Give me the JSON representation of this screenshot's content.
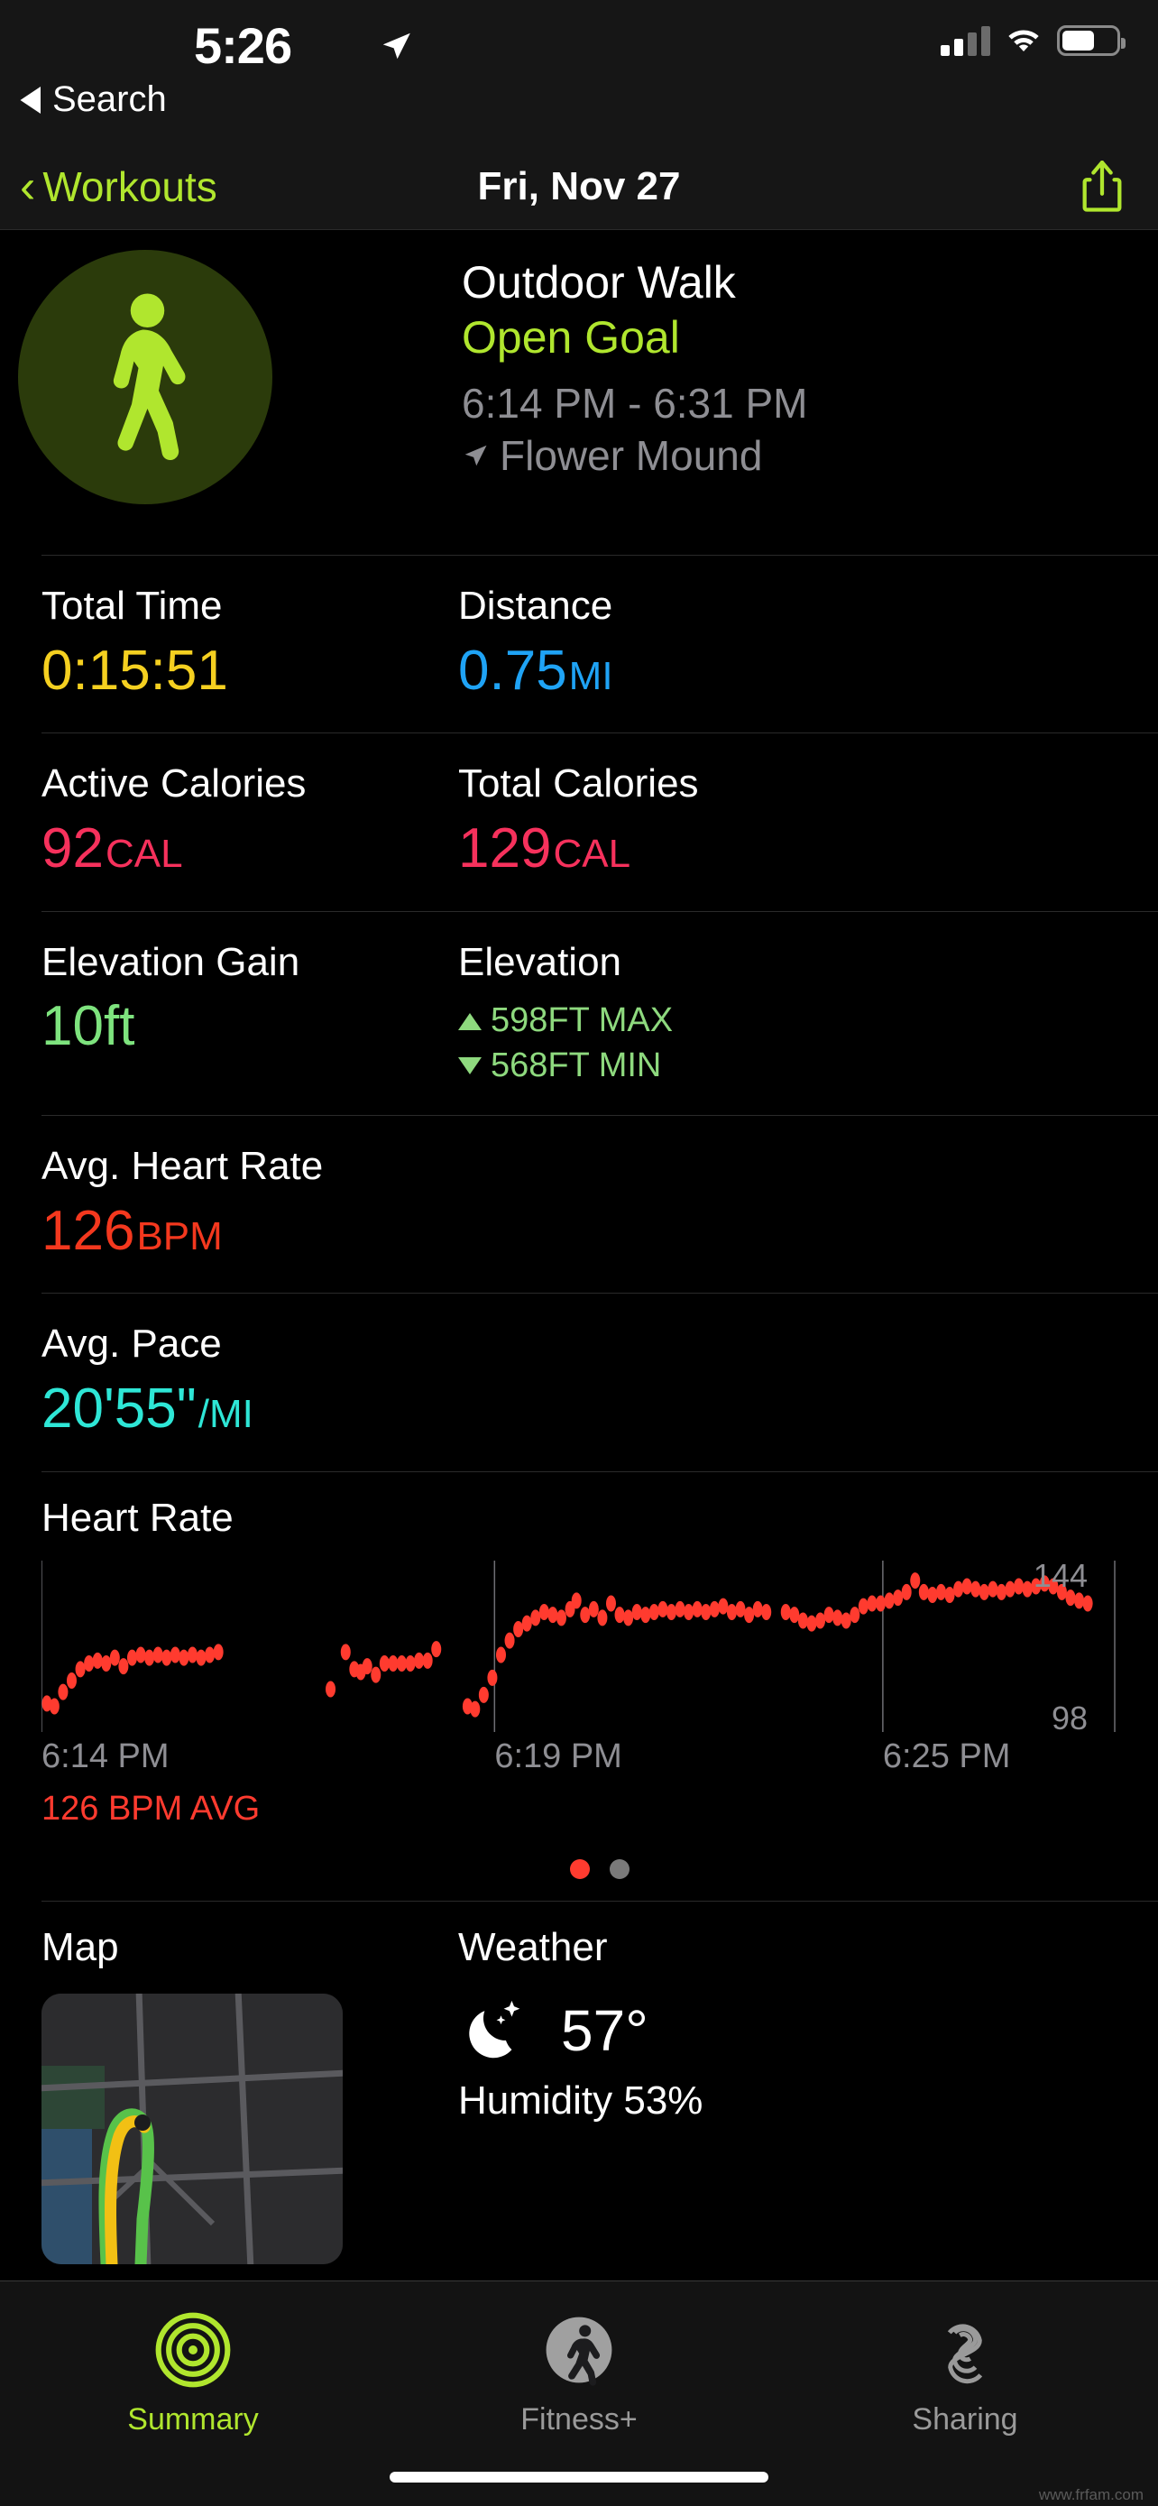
{
  "status_bar": {
    "time": "5:26",
    "back_label": "Search",
    "location_icon": "location-arrow-icon",
    "signal_icon": "cellular-signal-icon",
    "wifi_icon": "wifi-icon",
    "battery_icon": "battery-icon"
  },
  "nav": {
    "back_label": "Workouts",
    "title": "Fri, Nov 27",
    "share_icon": "share-icon",
    "accent": "#b0e62e"
  },
  "workout": {
    "icon": "walking-person-icon",
    "type": "Outdoor Walk",
    "goal": "Open Goal",
    "time_range": "6:14 PM - 6:31 PM",
    "location": "Flower Mound",
    "location_icon": "location-arrow-icon"
  },
  "metrics": [
    {
      "label": "Total Time",
      "value": "0:15:51",
      "unit": "",
      "color": "#f5d020",
      "label2": "Distance",
      "value2": "0.75",
      "unit2": "MI",
      "color2": "#1fa3f5"
    },
    {
      "label": "Active Calories",
      "value": "92",
      "unit": "CAL",
      "color": "#f6315c",
      "label2": "Total Calories",
      "value2": "129",
      "unit2": "CAL",
      "color2": "#f6315c"
    }
  ],
  "elevation": {
    "gain_label": "Elevation Gain",
    "gain_value": "10",
    "gain_unit": "ft",
    "gain_color": "#7ee37e",
    "label": "Elevation",
    "max": "598FT MAX",
    "min": "568FT MIN",
    "color": "#8ed97e"
  },
  "heart_rate_metric": {
    "label": "Avg. Heart Rate",
    "value": "126",
    "unit": "BPM",
    "color": "#f4381e"
  },
  "pace_metric": {
    "label": "Avg. Pace",
    "value": "20'55\"",
    "unit": "/MI",
    "color": "#2ee6d6"
  },
  "chart_data": {
    "type": "scatter",
    "title": "Heart Rate",
    "xlabel": "",
    "ylabel": "",
    "ymax_label": "144",
    "ymin_label": "98",
    "ylim": [
      90,
      150
    ],
    "avg_label": "126 BPM AVG",
    "avg_color": "#ff3b2f",
    "point_color": "#ff3b2f",
    "grid": true,
    "xtick_labels": [
      "6:14 PM",
      "6:19 PM",
      "6:25 PM"
    ],
    "xtick_positions": [
      0,
      0.42,
      0.78
    ],
    "points": [
      [
        0.005,
        100
      ],
      [
        0.012,
        99
      ],
      [
        0.02,
        104
      ],
      [
        0.028,
        108
      ],
      [
        0.036,
        112
      ],
      [
        0.044,
        114
      ],
      [
        0.052,
        115
      ],
      [
        0.06,
        114
      ],
      [
        0.068,
        116
      ],
      [
        0.076,
        113
      ],
      [
        0.084,
        116
      ],
      [
        0.092,
        117
      ],
      [
        0.1,
        116
      ],
      [
        0.108,
        117
      ],
      [
        0.116,
        116
      ],
      [
        0.124,
        117
      ],
      [
        0.132,
        116
      ],
      [
        0.14,
        117
      ],
      [
        0.148,
        116
      ],
      [
        0.156,
        117
      ],
      [
        0.164,
        118
      ],
      [
        0.268,
        105
      ],
      [
        0.282,
        118
      ],
      [
        0.29,
        112
      ],
      [
        0.296,
        111
      ],
      [
        0.302,
        113
      ],
      [
        0.31,
        110
      ],
      [
        0.318,
        114
      ],
      [
        0.326,
        114
      ],
      [
        0.334,
        114
      ],
      [
        0.342,
        114
      ],
      [
        0.35,
        115
      ],
      [
        0.358,
        115
      ],
      [
        0.366,
        119
      ],
      [
        0.395,
        99
      ],
      [
        0.402,
        98
      ],
      [
        0.41,
        103
      ],
      [
        0.418,
        109
      ],
      [
        0.426,
        117
      ],
      [
        0.434,
        122
      ],
      [
        0.442,
        126
      ],
      [
        0.45,
        128
      ],
      [
        0.458,
        130
      ],
      [
        0.466,
        132
      ],
      [
        0.474,
        131
      ],
      [
        0.482,
        130
      ],
      [
        0.49,
        133
      ],
      [
        0.496,
        136
      ],
      [
        0.504,
        131
      ],
      [
        0.512,
        133
      ],
      [
        0.52,
        130
      ],
      [
        0.528,
        135
      ],
      [
        0.536,
        131
      ],
      [
        0.544,
        130
      ],
      [
        0.552,
        132
      ],
      [
        0.56,
        131
      ],
      [
        0.568,
        132
      ],
      [
        0.576,
        133
      ],
      [
        0.584,
        132
      ],
      [
        0.592,
        133
      ],
      [
        0.6,
        132
      ],
      [
        0.608,
        133
      ],
      [
        0.616,
        132
      ],
      [
        0.624,
        133
      ],
      [
        0.632,
        134
      ],
      [
        0.64,
        132
      ],
      [
        0.648,
        133
      ],
      [
        0.656,
        131
      ],
      [
        0.664,
        133
      ],
      [
        0.672,
        132
      ],
      [
        0.69,
        132
      ],
      [
        0.698,
        131
      ],
      [
        0.706,
        129
      ],
      [
        0.714,
        128
      ],
      [
        0.722,
        129
      ],
      [
        0.73,
        131
      ],
      [
        0.738,
        130
      ],
      [
        0.746,
        129
      ],
      [
        0.754,
        131
      ],
      [
        0.762,
        134
      ],
      [
        0.77,
        135
      ],
      [
        0.778,
        135
      ],
      [
        0.786,
        136
      ],
      [
        0.794,
        137
      ],
      [
        0.802,
        139
      ],
      [
        0.81,
        143
      ],
      [
        0.818,
        139
      ],
      [
        0.826,
        138
      ],
      [
        0.834,
        139
      ],
      [
        0.842,
        138
      ],
      [
        0.85,
        140
      ],
      [
        0.858,
        141
      ],
      [
        0.866,
        140
      ],
      [
        0.874,
        139
      ],
      [
        0.882,
        140
      ],
      [
        0.89,
        139
      ],
      [
        0.898,
        140
      ],
      [
        0.906,
        141
      ],
      [
        0.914,
        140
      ],
      [
        0.922,
        141
      ],
      [
        0.93,
        142
      ],
      [
        0.938,
        141
      ],
      [
        0.946,
        139
      ],
      [
        0.954,
        137
      ],
      [
        0.962,
        136
      ],
      [
        0.97,
        135
      ]
    ]
  },
  "page_dots": {
    "count": 2,
    "active_index": 0
  },
  "map": {
    "label": "Map",
    "thumbnail_icon": "map-thumbnail"
  },
  "weather": {
    "label": "Weather",
    "icon": "moon-stars-icon",
    "temperature": "57°",
    "humidity": "Humidity 53%"
  },
  "tabs": [
    {
      "label": "Summary",
      "icon": "activity-rings-icon",
      "active": true
    },
    {
      "label": "Fitness+",
      "icon": "running-person-icon",
      "active": false
    },
    {
      "label": "Sharing",
      "icon": "sharing-icon",
      "active": false
    }
  ],
  "watermark": "www.frfam.com"
}
